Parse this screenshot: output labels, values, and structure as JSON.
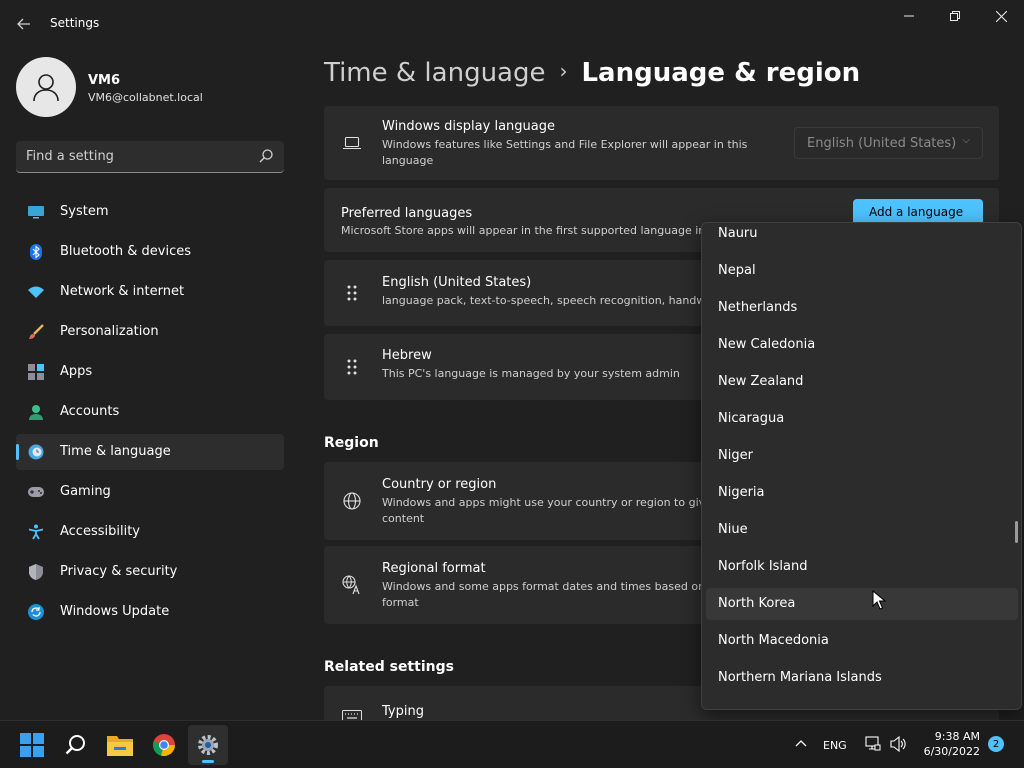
{
  "window": {
    "title": "Settings",
    "controls": {
      "minimize": "—",
      "maximize": "❐",
      "close": "✕"
    }
  },
  "user": {
    "name": "VM6",
    "email": "VM6@collabnet.local"
  },
  "search": {
    "placeholder": "Find a setting",
    "value": ""
  },
  "sidebar": {
    "items": [
      {
        "label": "System",
        "icon": "system-icon",
        "active": false
      },
      {
        "label": "Bluetooth & devices",
        "icon": "bluetooth-icon",
        "active": false
      },
      {
        "label": "Network & internet",
        "icon": "wifi-icon",
        "active": false
      },
      {
        "label": "Personalization",
        "icon": "brush-icon",
        "active": false
      },
      {
        "label": "Apps",
        "icon": "apps-icon",
        "active": false
      },
      {
        "label": "Accounts",
        "icon": "accounts-icon",
        "active": false
      },
      {
        "label": "Time & language",
        "icon": "clock-globe-icon",
        "active": true
      },
      {
        "label": "Gaming",
        "icon": "gamepad-icon",
        "active": false
      },
      {
        "label": "Accessibility",
        "icon": "accessibility-icon",
        "active": false
      },
      {
        "label": "Privacy & security",
        "icon": "shield-icon",
        "active": false
      },
      {
        "label": "Windows Update",
        "icon": "update-icon",
        "active": false
      }
    ]
  },
  "breadcrumb": {
    "parent": "Time & language",
    "separator": "›",
    "current": "Language & region"
  },
  "display_language": {
    "title": "Windows display language",
    "desc_line1": "Windows features like Settings and File Explorer will appear in this",
    "desc_line2": "language",
    "value": "English (United States)"
  },
  "preferred": {
    "title": "Preferred languages",
    "desc": "Microsoft Store apps will appear in the first supported language in",
    "button": "Add a language"
  },
  "languages": [
    {
      "title": "English (United States)",
      "desc": "language pack, text-to-speech, speech recognition, handw"
    },
    {
      "title": "Hebrew",
      "desc": "This PC's language is managed by your system admin"
    }
  ],
  "region": {
    "heading": "Region",
    "country": {
      "title": "Country or region",
      "desc_line1": "Windows and apps might use your country or region to giv",
      "desc_line2": "content"
    },
    "format": {
      "title": "Regional format",
      "desc_line1": "Windows and some apps format dates and times based on",
      "desc_line2": "format"
    }
  },
  "related": {
    "heading": "Related settings",
    "typing": "Typing"
  },
  "dropdown": {
    "items": [
      "Nauru",
      "Nepal",
      "Netherlands",
      "New Caledonia",
      "New Zealand",
      "Nicaragua",
      "Niger",
      "Nigeria",
      "Niue",
      "Norfolk Island",
      "North Korea",
      "North Macedonia",
      "Northern Mariana Islands"
    ],
    "hovered": "North Korea"
  },
  "taskbar": {
    "language": "ENG",
    "time": "9:38 AM",
    "date": "6/30/2022",
    "notifications": "2"
  },
  "colors": {
    "accent": "#4cc2ff",
    "background": "#202020",
    "card": "#2b2b2b"
  }
}
